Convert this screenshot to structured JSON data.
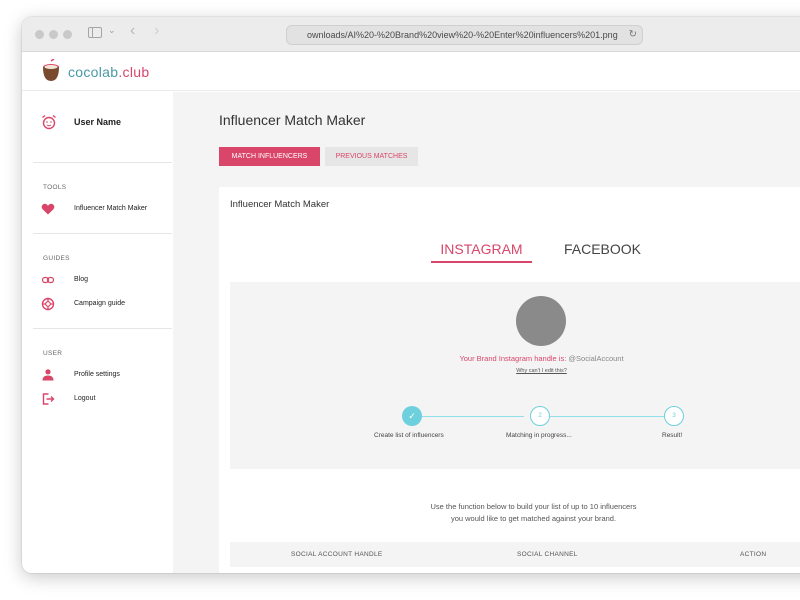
{
  "browser": {
    "url": "ownloads/AI%20-%20Brand%20view%20-%20Enter%20influencers%201.png"
  },
  "app": {
    "logo_part1": "cocolab",
    "logo_part2": ".club"
  },
  "sidebar": {
    "user_name": "User Name",
    "sections": {
      "tools": "TOOLS",
      "guides": "GUIDES",
      "user": "USER"
    },
    "items": {
      "influencer_match_maker": "Influencer Match Maker",
      "blog": "Blog",
      "campaign_guide": "Campaign guide",
      "profile_settings": "Profile settings",
      "logout": "Logout"
    }
  },
  "main": {
    "page_title": "Influencer Match Maker",
    "buttons": {
      "match": "MATCH INFLUENCERS",
      "previous": "PREVIOUS MATCHES"
    },
    "card_title": "Influencer Match Maker",
    "tabs": {
      "instagram": "INSTAGRAM",
      "facebook": "FACEBOOK"
    },
    "handle_prefix": "Your Brand Instagram handle is:",
    "handle_value": "@SocialAccount",
    "edit_link": "Why can't I edit this?",
    "steps": [
      {
        "label": "Create list of influencers",
        "number": "",
        "status": "done"
      },
      {
        "label": "Matching in progress...",
        "number": "2",
        "status": "pending"
      },
      {
        "label": "Result!",
        "number": "3",
        "status": "pending"
      }
    ],
    "description_line1": "Use the function below to build your list of up to 10 influencers",
    "description_line2": "you would like to get matched against your brand.",
    "table_headers": {
      "handle": "SOCIAL ACCOUNT HANDLE",
      "channel": "SOCIAL CHANNEL",
      "action": "ACTION"
    }
  },
  "colors": {
    "brand_pink": "#d9466a",
    "brand_teal": "#4a9aa6",
    "step_cyan": "#6ed0dc"
  }
}
